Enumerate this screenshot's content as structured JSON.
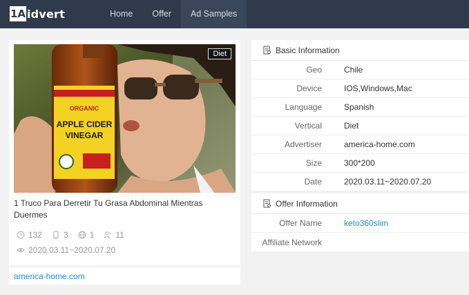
{
  "brand": {
    "mark": "1A",
    "name": "idvert"
  },
  "nav": [
    {
      "label": "Home",
      "active": false
    },
    {
      "label": "Offer",
      "active": false
    },
    {
      "label": "Ad Samples",
      "active": true
    }
  ],
  "ad": {
    "tag": "Diet",
    "title": "1 Truco Para Derretir Tu Grasa Abdominal Mientras Duermes",
    "stats": {
      "views": "132",
      "devices": "3",
      "geos": "1",
      "users": "11"
    },
    "date_range": "2020.03.11~2020.07.20",
    "domain": "america-home.com",
    "image_icon": "woman-drinking-vinegar-image"
  },
  "basic_info": {
    "title": "Basic Information",
    "rows": [
      {
        "key": "Geo",
        "value": "Chile"
      },
      {
        "key": "Device",
        "value": "IOS,Windows,Mac"
      },
      {
        "key": "Language",
        "value": "Spanish"
      },
      {
        "key": "Vertical",
        "value": "Diet"
      },
      {
        "key": "Advertiser",
        "value": "america-home.com"
      },
      {
        "key": "Size",
        "value": "300*200"
      },
      {
        "key": "Date",
        "value": "2020.03.11~2020.07.20"
      }
    ]
  },
  "offer_info": {
    "title": "Offer Information",
    "rows": [
      {
        "key": "Offer Name",
        "value": "keto360slim"
      },
      {
        "key": "Affiliate Network",
        "value": ""
      }
    ]
  },
  "colors": {
    "topbar": "#2f3a4c",
    "link": "#1a8fd6",
    "background": "#f2f2f2"
  }
}
